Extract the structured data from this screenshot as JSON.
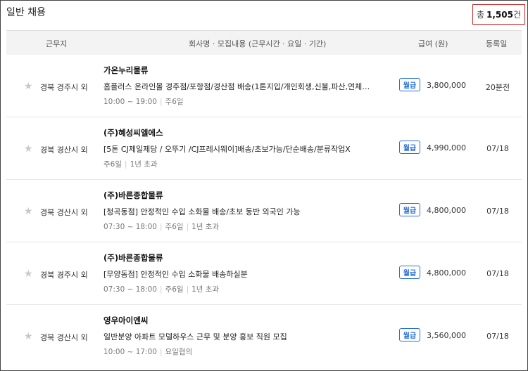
{
  "header": {
    "title": "일반 채용",
    "total_prefix": "총",
    "total_count": "1,505",
    "total_suffix": "건"
  },
  "columns": {
    "location": "근무지",
    "content": "회사명 · 모집내용 (근무시간 · 요일 · 기간)",
    "salary": "급여 (원)",
    "date": "등록일"
  },
  "star_icon": "★",
  "rows": [
    {
      "location": "경북 경주시 외",
      "company": "가온누리물류",
      "title": "홈플러스 온라인몰 경주점/포항점/경산점 배송(1톤지입/개인회생,신불,파산,연체…",
      "meta": [
        "10:00 ~ 19:00",
        "주6일"
      ],
      "pay_type": "월급",
      "salary": "3,800,000",
      "date": "20분전"
    },
    {
      "location": "경북 경산시 외",
      "company": "(주)혜성씨엘에스",
      "title": "[5톤 CJ제일제당 / 오뚜기 /CJ프레시웨이]배송/초보가능/단순배송/분류작업X",
      "meta": [
        "주6일",
        "1년 초과"
      ],
      "pay_type": "월급",
      "salary": "4,990,000",
      "date": "07/18"
    },
    {
      "location": "경북 경산시 외",
      "company": "(주)바른종합물류",
      "title": "[청곡동점] 안정적인 수입 소화물 배송/초보 동반 외국인 가능",
      "meta": [
        "07:30 ~ 18:00",
        "주6일",
        "1년 초과"
      ],
      "pay_type": "월급",
      "salary": "4,800,000",
      "date": "07/18"
    },
    {
      "location": "경북 경주시 외",
      "company": "(주)바른종합물류",
      "title": "[무양동점] 안정적인 수입 소화물 배송하실분",
      "meta": [
        "07:30 ~ 18:00",
        "주6일",
        "1년 초과"
      ],
      "pay_type": "월급",
      "salary": "4,800,000",
      "date": "07/18"
    },
    {
      "location": "경북 경산시 외",
      "company": "영우아이엔씨",
      "title": "일반분양 아파트 모델하우스 근무 및 분양 홍보 직원 모집",
      "meta": [
        "10:00 ~ 17:00",
        "요일협의"
      ],
      "pay_type": "월급",
      "salary": "3,560,000",
      "date": "07/18"
    }
  ]
}
